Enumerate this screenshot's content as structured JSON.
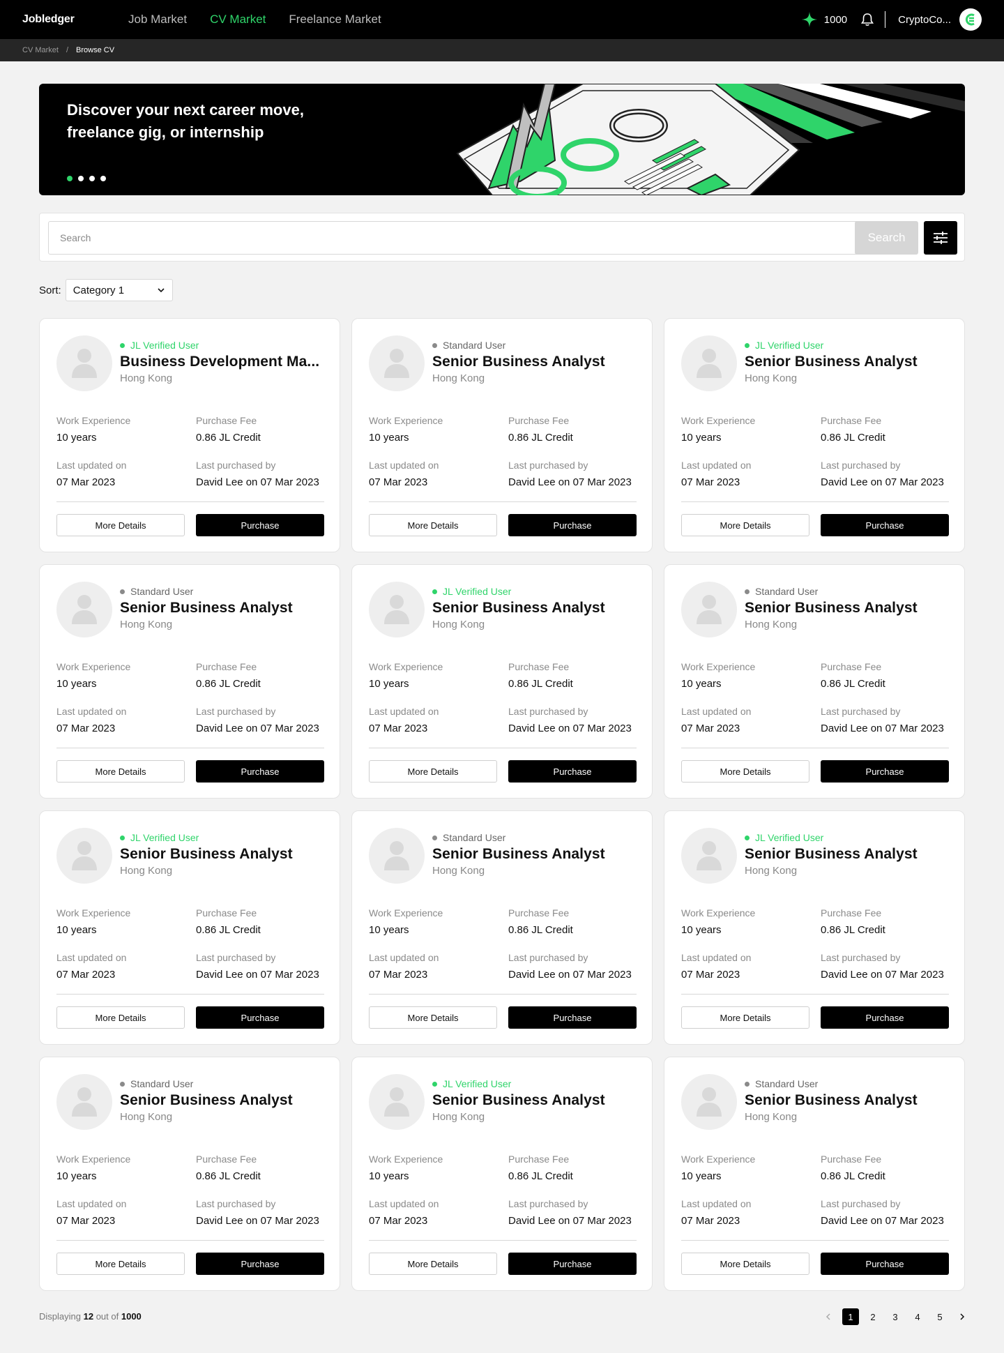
{
  "nav": {
    "logo": "Jobledger",
    "links": [
      "Job Market",
      "CV Market",
      "Freelance Market"
    ],
    "active_link": "CV Market",
    "credits": "1000",
    "user_name": "CryptoCo..."
  },
  "breadcrumb": [
    "CV Market",
    "Browse CV"
  ],
  "banner": {
    "headline": "Discover your next career move, freelance gig, or internship",
    "slides": 4,
    "active_slide": 1
  },
  "search": {
    "placeholder": "Search",
    "button_label": "Search"
  },
  "sort": {
    "label": "Sort:",
    "selected": "Category 1"
  },
  "labels": {
    "work_experience": "Work Experience",
    "purchase_fee": "Purchase Fee",
    "last_updated": "Last updated on",
    "last_purchased": "Last purchased by",
    "more_details": "More Details",
    "purchase": "Purchase"
  },
  "cards": [
    {
      "status": "JL Verified User",
      "verified": true,
      "title": "Business Development Ma...",
      "location": "Hong Kong",
      "experience": "10 years",
      "fee": "0.86 JL Credit",
      "updated": "07 Mar 2023",
      "purchased": "David Lee on 07 Mar 2023"
    },
    {
      "status": "Standard User",
      "verified": false,
      "title": "Senior Business Analyst",
      "location": "Hong Kong",
      "experience": "10 years",
      "fee": "0.86 JL Credit",
      "updated": "07 Mar 2023",
      "purchased": "David Lee on 07 Mar 2023"
    },
    {
      "status": "JL Verified User",
      "verified": true,
      "title": "Senior Business Analyst",
      "location": "Hong Kong",
      "experience": "10 years",
      "fee": "0.86 JL Credit",
      "updated": "07 Mar 2023",
      "purchased": "David Lee on 07 Mar 2023"
    },
    {
      "status": "Standard User",
      "verified": false,
      "title": "Senior Business Analyst",
      "location": "Hong Kong",
      "experience": "10 years",
      "fee": "0.86 JL Credit",
      "updated": "07 Mar 2023",
      "purchased": "David Lee on 07 Mar 2023"
    },
    {
      "status": "JL Verified User",
      "verified": true,
      "title": "Senior Business Analyst",
      "location": "Hong Kong",
      "experience": "10 years",
      "fee": "0.86 JL Credit",
      "updated": "07 Mar 2023",
      "purchased": "David Lee on 07 Mar 2023"
    },
    {
      "status": "Standard User",
      "verified": false,
      "title": "Senior Business Analyst",
      "location": "Hong Kong",
      "experience": "10 years",
      "fee": "0.86 JL Credit",
      "updated": "07 Mar 2023",
      "purchased": "David Lee on 07 Mar 2023"
    },
    {
      "status": "JL Verified User",
      "verified": true,
      "title": "Senior Business Analyst",
      "location": "Hong Kong",
      "experience": "10 years",
      "fee": "0.86 JL Credit",
      "updated": "07 Mar 2023",
      "purchased": "David Lee on 07 Mar 2023"
    },
    {
      "status": "Standard User",
      "verified": false,
      "title": "Senior Business Analyst",
      "location": "Hong Kong",
      "experience": "10 years",
      "fee": "0.86 JL Credit",
      "updated": "07 Mar 2023",
      "purchased": "David Lee on 07 Mar 2023"
    },
    {
      "status": "JL Verified User",
      "verified": true,
      "title": "Senior Business Analyst",
      "location": "Hong Kong",
      "experience": "10 years",
      "fee": "0.86 JL Credit",
      "updated": "07 Mar 2023",
      "purchased": "David Lee on 07 Mar 2023"
    },
    {
      "status": "Standard User",
      "verified": false,
      "title": "Senior Business Analyst",
      "location": "Hong Kong",
      "experience": "10 years",
      "fee": "0.86 JL Credit",
      "updated": "07 Mar 2023",
      "purchased": "David Lee on 07 Mar 2023"
    },
    {
      "status": "JL Verified User",
      "verified": true,
      "title": "Senior Business Analyst",
      "location": "Hong Kong",
      "experience": "10 years",
      "fee": "0.86 JL Credit",
      "updated": "07 Mar 2023",
      "purchased": "David Lee on 07 Mar 2023"
    },
    {
      "status": "Standard User",
      "verified": false,
      "title": "Senior Business Analyst",
      "location": "Hong Kong",
      "experience": "10 years",
      "fee": "0.86 JL Credit",
      "updated": "07 Mar 2023",
      "purchased": "David Lee on 07 Mar 2023"
    }
  ],
  "footer": {
    "displaying_prefix": "Displaying",
    "displaying_count": "12",
    "displaying_mid": "out of",
    "displaying_total": "1000"
  },
  "pagination": {
    "pages": [
      "1",
      "2",
      "3",
      "4",
      "5"
    ],
    "current": "1",
    "prev_icon": "chevron-left-icon",
    "next_icon": "chevron-right-icon"
  },
  "colors": {
    "accent": "#2fd46a",
    "nav_bg": "#000000",
    "breadcrumb_bg": "#262626",
    "page_bg": "#f2f2f2"
  }
}
